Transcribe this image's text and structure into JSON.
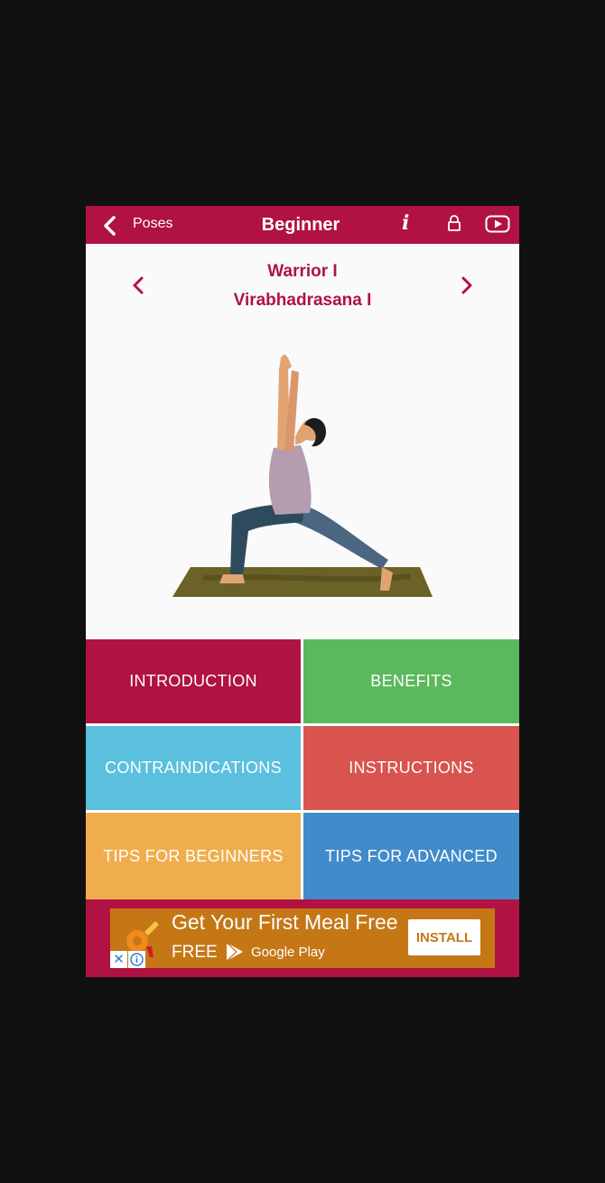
{
  "header": {
    "back_label": "Poses",
    "title": "Beginner"
  },
  "pose": {
    "name": "Warrior I",
    "sanskrit": "Virabhadrasana I"
  },
  "tiles": [
    {
      "label": "INTRODUCTION",
      "color": "#b01243"
    },
    {
      "label": "BENEFITS",
      "color": "#5cb85c"
    },
    {
      "label": "CONTRAINDICATIONS",
      "color": "#5bc0de"
    },
    {
      "label": "INSTRUCTIONS",
      "color": "#d9534f"
    },
    {
      "label": "TIPS FOR BEGINNERS",
      "color": "#f0ad4e"
    },
    {
      "label": "TIPS FOR ADVANCED",
      "color": "#428bca"
    }
  ],
  "ad": {
    "headline": "Get Your First Meal Free",
    "price": "FREE",
    "store": "Google Play",
    "cta": "INSTALL"
  },
  "colors": {
    "brand": "#b01243",
    "ad_bg": "#c57716"
  },
  "icons": [
    "chevron-left-icon",
    "info-icon",
    "lock-icon",
    "video-play-icon",
    "chevron-right-icon",
    "close-icon",
    "adchoices-icon",
    "google-play-icon",
    "ad-app-logo"
  ]
}
